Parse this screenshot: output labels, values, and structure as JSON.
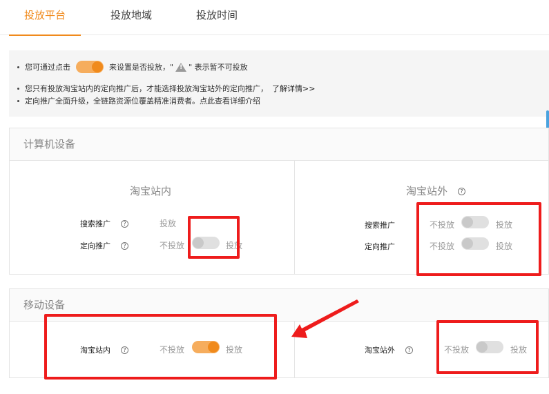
{
  "tabs": [
    {
      "label": "投放平台",
      "active": true
    },
    {
      "label": "投放地域",
      "active": false
    },
    {
      "label": "投放时间",
      "active": false
    }
  ],
  "notice": {
    "line1_before": "您可通过点击",
    "line1_after": "来设置是否投放，\"",
    "line1_end": "\" 表示暂不可投放",
    "line2": "您只有投放淘宝站内的定向推广后，才能选择投放淘宝站外的定向推广，",
    "line2_link": "了解详情>>",
    "line3": "定向推广全面升级，全链路资源位覆盖精准消费者。点此查看详细介绍"
  },
  "options": {
    "off": "不投放",
    "on": "投放"
  },
  "computer": {
    "title": "计算机设备",
    "inside": {
      "title": "淘宝站内",
      "rows": [
        {
          "label": "搜索推广",
          "state": "fixed-on"
        },
        {
          "label": "定向推广",
          "state": "off"
        }
      ]
    },
    "outside": {
      "title": "淘宝站外",
      "rows": [
        {
          "label": "搜索推广",
          "state": "off"
        },
        {
          "label": "定向推广",
          "state": "off"
        }
      ]
    }
  },
  "mobile": {
    "title": "移动设备",
    "inside": {
      "label": "淘宝站内",
      "state": "on"
    },
    "outside": {
      "label": "淘宝站外",
      "state": "off"
    }
  },
  "help_glyph": "?",
  "colors": {
    "accent": "#f08a1c",
    "annotation_red": "#ee1c1c"
  }
}
